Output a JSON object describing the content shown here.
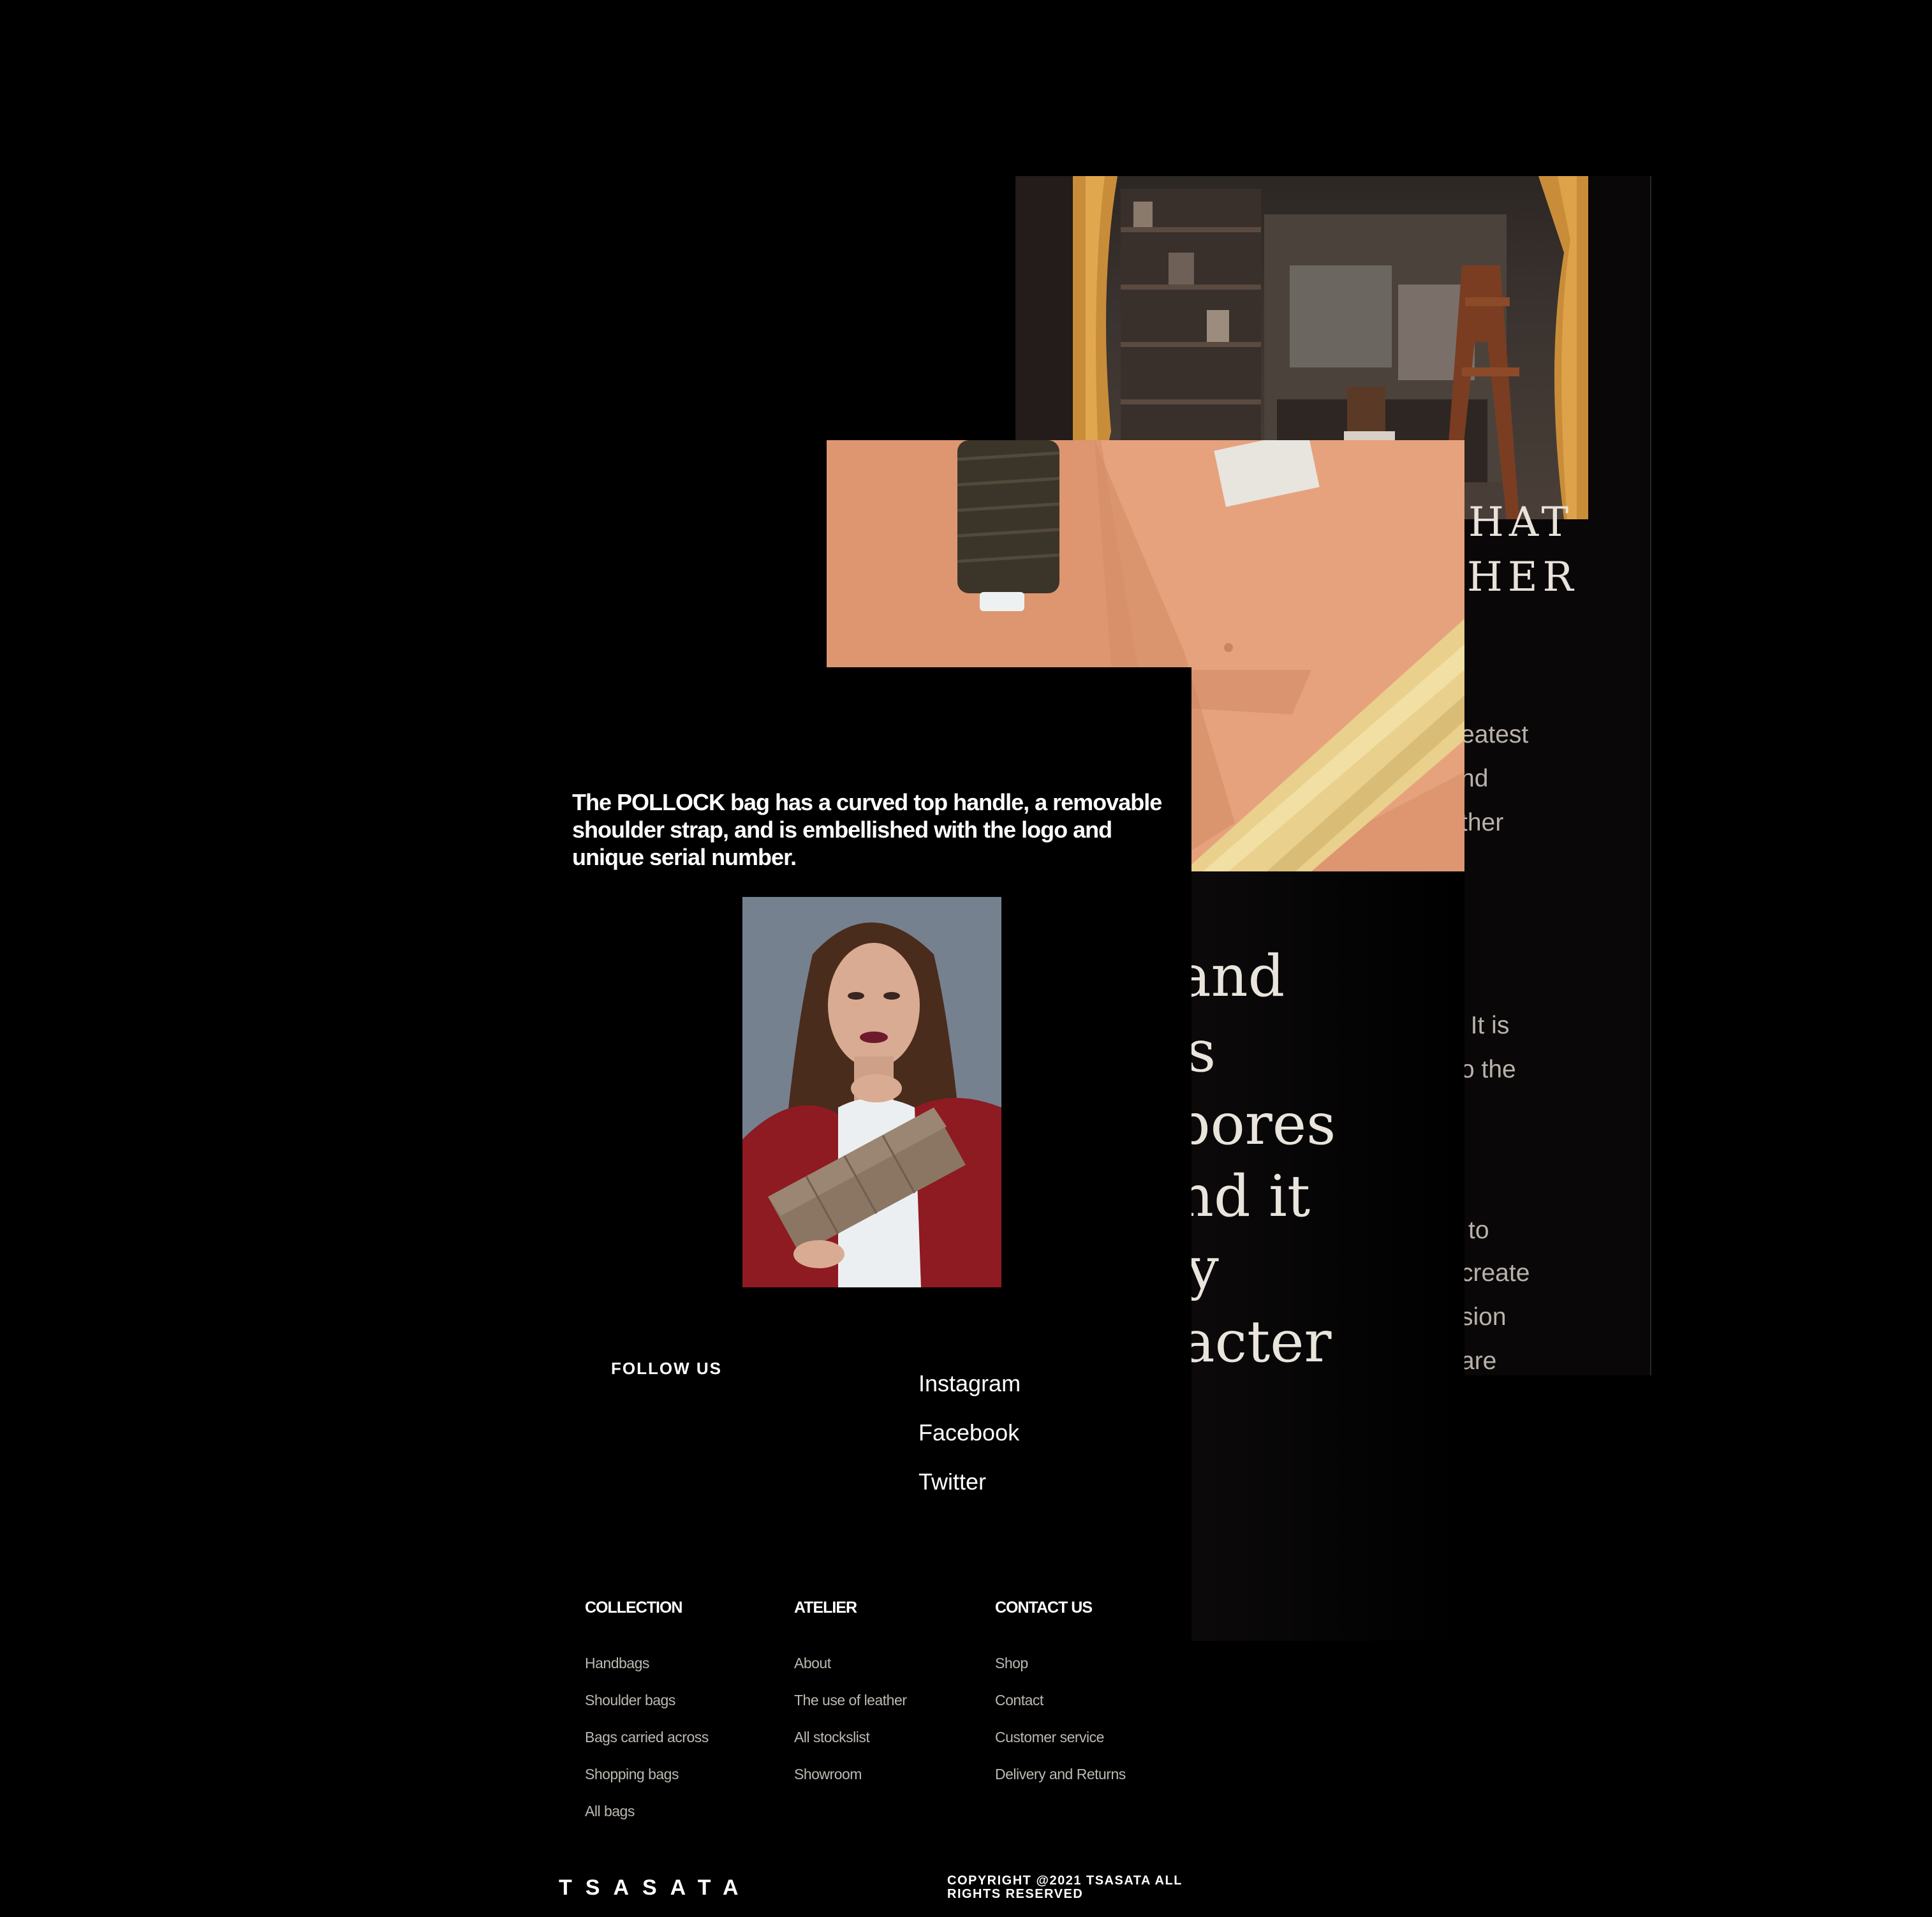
{
  "back_panel": {
    "heading_fragments": [
      "HAT",
      "HER"
    ],
    "paragraph_fragments": [
      "eatest",
      "nd",
      "ther",
      ". It is",
      "o the",
      "to",
      "create",
      "sion",
      "are"
    ]
  },
  "middle_panel": {
    "quote_fragments": [
      "and",
      "s",
      "pores",
      "nd it",
      "y",
      "racter"
    ]
  },
  "product": {
    "description": "The POLLOCK bag has a curved top handle, a removable shoulder strap, and is embellished with the logo and unique serial number."
  },
  "social": {
    "label": "FOLLOW US",
    "links": [
      "Instagram",
      "Facebook",
      "Twitter"
    ]
  },
  "footer": {
    "columns": [
      {
        "title": "COLLECTION",
        "links": [
          "Handbags",
          "Shoulder bags",
          "Bags carried across",
          "Shopping bags",
          "All bags"
        ]
      },
      {
        "title": "ATELIER",
        "links": [
          "About",
          "The use of leather",
          "All stockslist",
          "Showroom"
        ]
      },
      {
        "title": "CONTACT US",
        "links": [
          "Shop",
          "Contact",
          "Customer service",
          "Delivery and Returns"
        ]
      }
    ],
    "brand": "TSASATA",
    "copyright": "COPYRIGHT @2021 TSASATA ALL RIGHTS RESERVED"
  }
}
